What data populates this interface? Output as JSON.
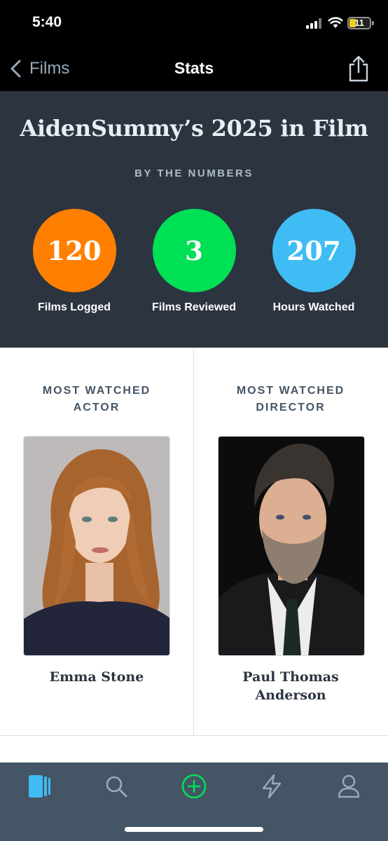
{
  "status_bar": {
    "time": "5:40",
    "battery_level": "11"
  },
  "nav": {
    "back_label": "Films",
    "title": "Stats"
  },
  "hero": {
    "title": "AidenSummy’s 2025 in Film",
    "subtitle": "BY THE NUMBERS",
    "stats": [
      {
        "value": "120",
        "label": "Films Logged",
        "color": "#ff8000"
      },
      {
        "value": "3",
        "label": "Films Reviewed",
        "color": "#00e054"
      },
      {
        "value": "207",
        "label": "Hours Watched",
        "color": "#40bcf4"
      }
    ]
  },
  "most_watched": {
    "actor": {
      "heading_line1": "MOST WATCHED",
      "heading_line2": "ACTOR",
      "name": "Emma Stone"
    },
    "director": {
      "heading_line1": "MOST WATCHED",
      "heading_line2": "DIRECTOR",
      "name_line1": "Paul Thomas",
      "name_line2": "Anderson"
    }
  },
  "tab_bar": {
    "tabs": [
      {
        "icon": "films-icon",
        "active": true
      },
      {
        "icon": "search-icon",
        "active": false
      },
      {
        "icon": "add-icon",
        "active": false
      },
      {
        "icon": "activity-icon",
        "active": false
      },
      {
        "icon": "profile-icon",
        "active": false
      }
    ]
  },
  "colors": {
    "hero_bg": "#2c3440",
    "tab_bar_bg": "#445566",
    "accent_green": "#00e054",
    "active_tab": "#40bcf4"
  }
}
